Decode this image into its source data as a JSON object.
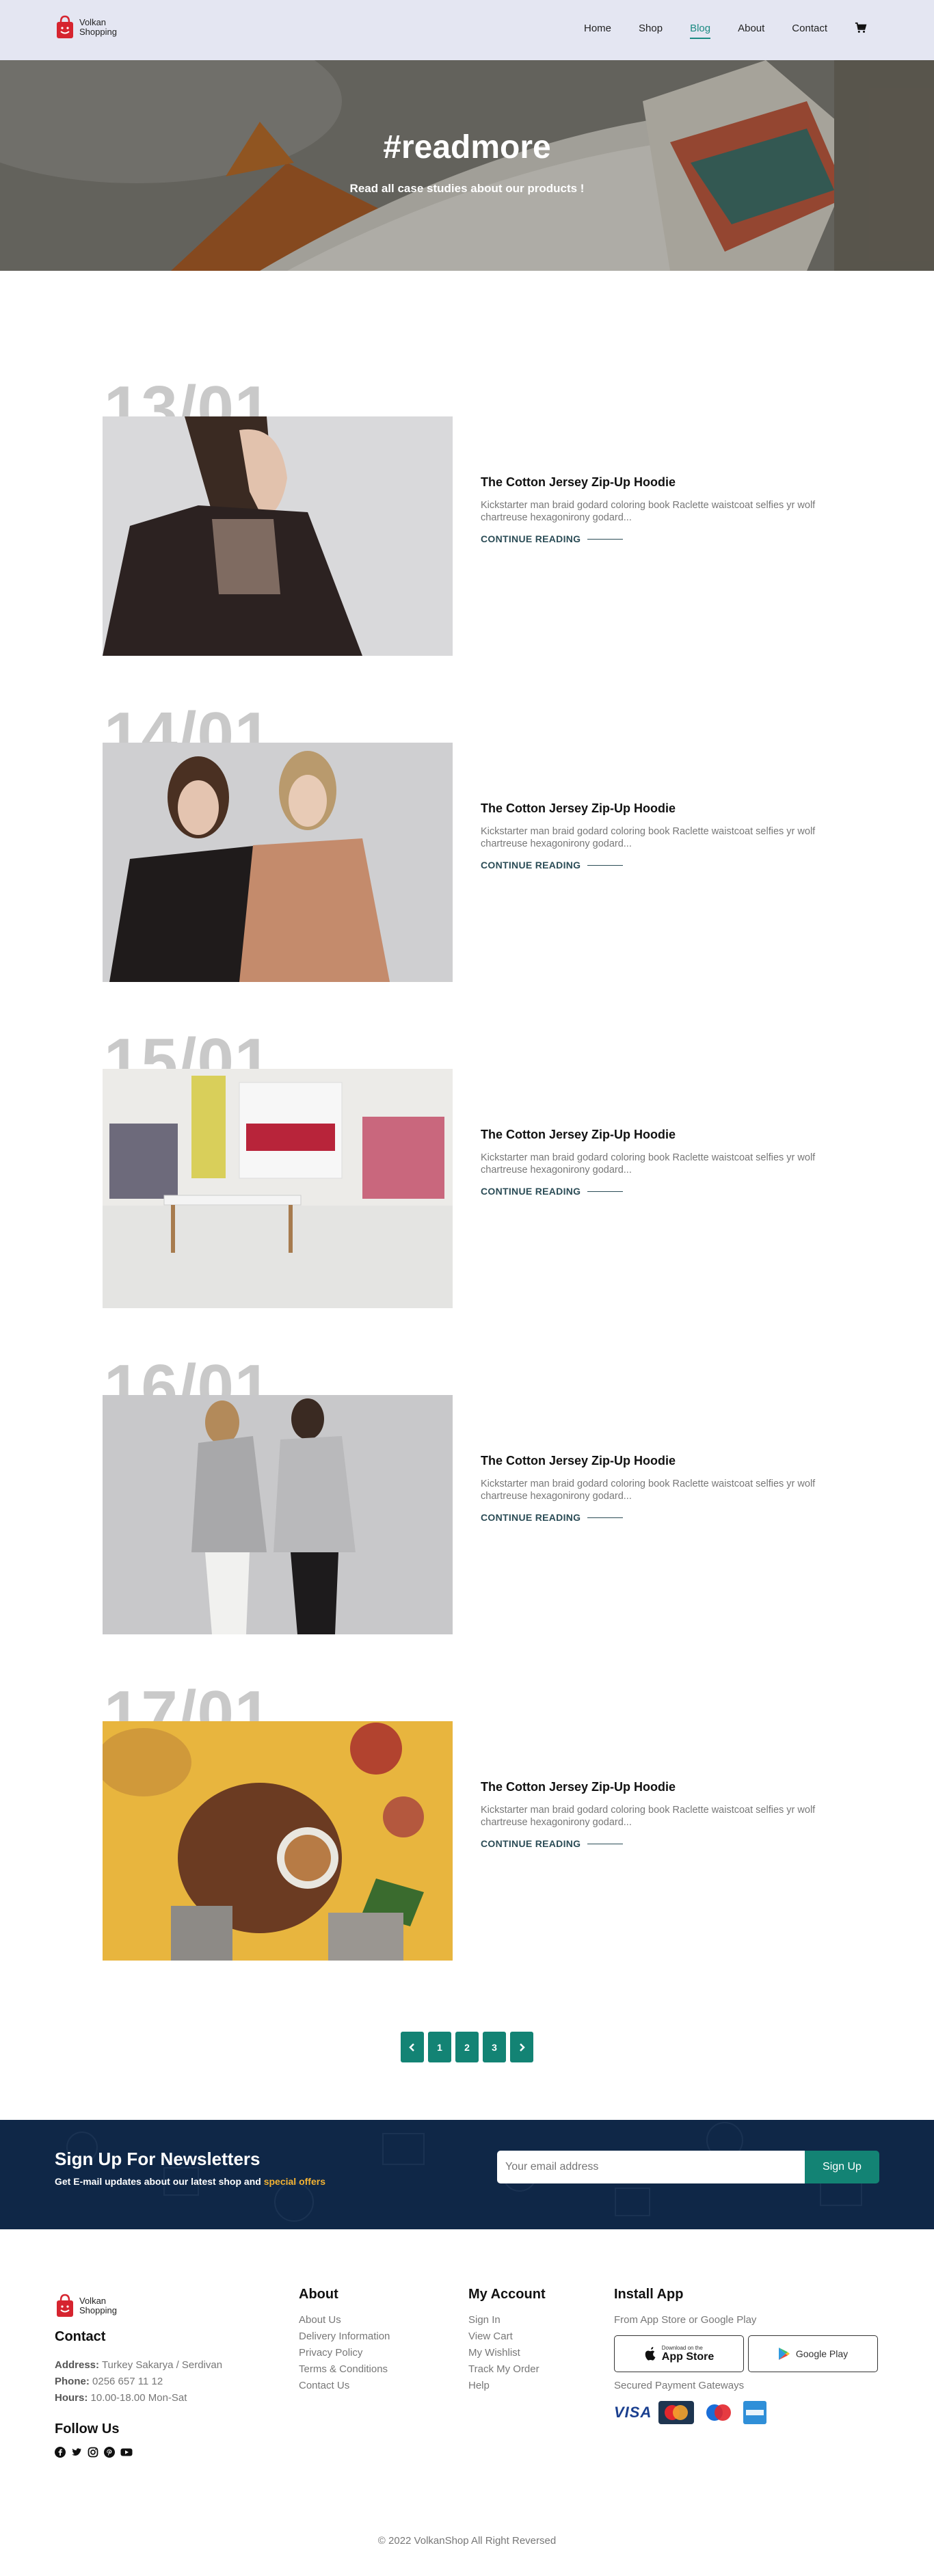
{
  "brand": {
    "line1": "Volkan",
    "line2": "Shopping"
  },
  "nav": {
    "items": [
      {
        "label": "Home",
        "active": false
      },
      {
        "label": "Shop",
        "active": false
      },
      {
        "label": "Blog",
        "active": true
      },
      {
        "label": "About",
        "active": false
      },
      {
        "label": "Contact",
        "active": false
      }
    ],
    "cart_icon": "cart-icon"
  },
  "hero": {
    "title": "#readmore",
    "subtitle": "Read all case studies about our products !"
  },
  "posts": [
    {
      "date": "13/01",
      "title": "The Cotton Jersey Zip-Up Hoodie",
      "excerpt": "Kickstarter man braid godard coloring book Raclette waistcoat selfies yr wolf chartreuse hexagonirony godard...",
      "link": "CONTINUE READING"
    },
    {
      "date": "14/01",
      "title": "The Cotton Jersey Zip-Up Hoodie",
      "excerpt": "Kickstarter man braid godard coloring book Raclette waistcoat selfies yr wolf chartreuse hexagonirony godard...",
      "link": "CONTINUE READING"
    },
    {
      "date": "15/01",
      "title": "The Cotton Jersey Zip-Up Hoodie",
      "excerpt": "Kickstarter man braid godard coloring book Raclette waistcoat selfies yr wolf chartreuse hexagonirony godard...",
      "link": "CONTINUE READING"
    },
    {
      "date": "16/01",
      "title": "The Cotton Jersey Zip-Up Hoodie",
      "excerpt": "Kickstarter man braid godard coloring book Raclette waistcoat selfies yr wolf chartreuse hexagonirony godard...",
      "link": "CONTINUE READING"
    },
    {
      "date": "17/01",
      "title": "The Cotton Jersey Zip-Up Hoodie",
      "excerpt": "Kickstarter man braid godard coloring book Raclette waistcoat selfies yr wolf chartreuse hexagonirony godard...",
      "link": "CONTINUE READING"
    }
  ],
  "pagination": {
    "prev_icon": "chevron-left-icon",
    "pages": [
      "1",
      "2",
      "3"
    ],
    "next_icon": "chevron-right-icon"
  },
  "newsletter": {
    "title": "Sign Up For Newsletters",
    "subtitle": "Get E-mail updates about our latest shop and",
    "subtitle_accent": "special offers",
    "placeholder": "Your email address",
    "button": "Sign Up"
  },
  "footer": {
    "contact": {
      "title": "Contact",
      "address_label": "Address:",
      "address": "Turkey Sakarya / Serdivan",
      "phone_label": "Phone:",
      "phone": "0256 657 11 12",
      "hours_label": "Hours:",
      "hours": "10.00-18.00 Mon-Sat"
    },
    "follow_title": "Follow Us",
    "about": {
      "title": "About",
      "links": [
        "About Us",
        "Delivery Information",
        "Privacy Policy",
        "Terms & Conditions",
        "Contact Us"
      ]
    },
    "account": {
      "title": "My Account",
      "links": [
        "Sign In",
        "View Cart",
        "My Wishlist",
        "Track My Order",
        "Help"
      ]
    },
    "app": {
      "title": "Install App",
      "subtitle": "From App Store or Google Play",
      "appstore_small": "Download on the",
      "appstore_big": "App Store",
      "googleplay": "Google Play",
      "payments_label": "Secured Payment Gateways",
      "visa": "VISA"
    },
    "copyright": "© 2022 VolkanShop All Right Reversed"
  },
  "colors": {
    "accent": "#138374",
    "navy": "#0f2747",
    "offer": "#f2b233",
    "header_bg": "#e4e6f2"
  }
}
